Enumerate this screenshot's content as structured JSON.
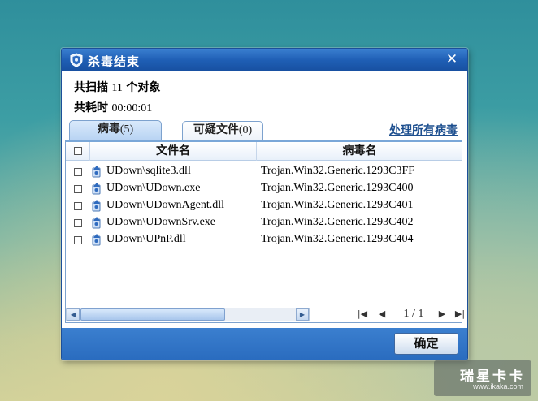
{
  "window": {
    "title": "杀毒结束",
    "close_label": "✕"
  },
  "summary": {
    "scanned_label": "共扫描",
    "scanned_count": "11",
    "scanned_unit": "个对象",
    "time_label": "共耗时",
    "time_value": "00:00:01"
  },
  "tabs": [
    {
      "label": "病毒",
      "count": "(5)",
      "active": true
    },
    {
      "label": "可疑文件",
      "count": "(0)",
      "active": false
    }
  ],
  "process_all_label": "处理所有病毒",
  "table": {
    "columns": [
      "文件名",
      "病毒名"
    ],
    "rows": [
      {
        "file": "UDown\\sqlite3.dll",
        "virus": "Trojan.Win32.Generic.1293C3FF"
      },
      {
        "file": "UDown\\UDown.exe",
        "virus": "Trojan.Win32.Generic.1293C400"
      },
      {
        "file": "UDown\\UDownAgent.dll",
        "virus": "Trojan.Win32.Generic.1293C401"
      },
      {
        "file": "UDown\\UDownSrv.exe",
        "virus": "Trojan.Win32.Generic.1293C402"
      },
      {
        "file": "UDown\\UPnP.dll",
        "virus": "Trojan.Win32.Generic.1293C404"
      }
    ]
  },
  "pager": {
    "text": "1 / 1"
  },
  "ok_label": "确定",
  "watermark": {
    "text": "瑞星卡卡",
    "url": "www.ikaka.com"
  },
  "colors": {
    "titlebar": "#1f5fb5",
    "footer": "#2a6cbf",
    "link": "#1d4f8f"
  }
}
